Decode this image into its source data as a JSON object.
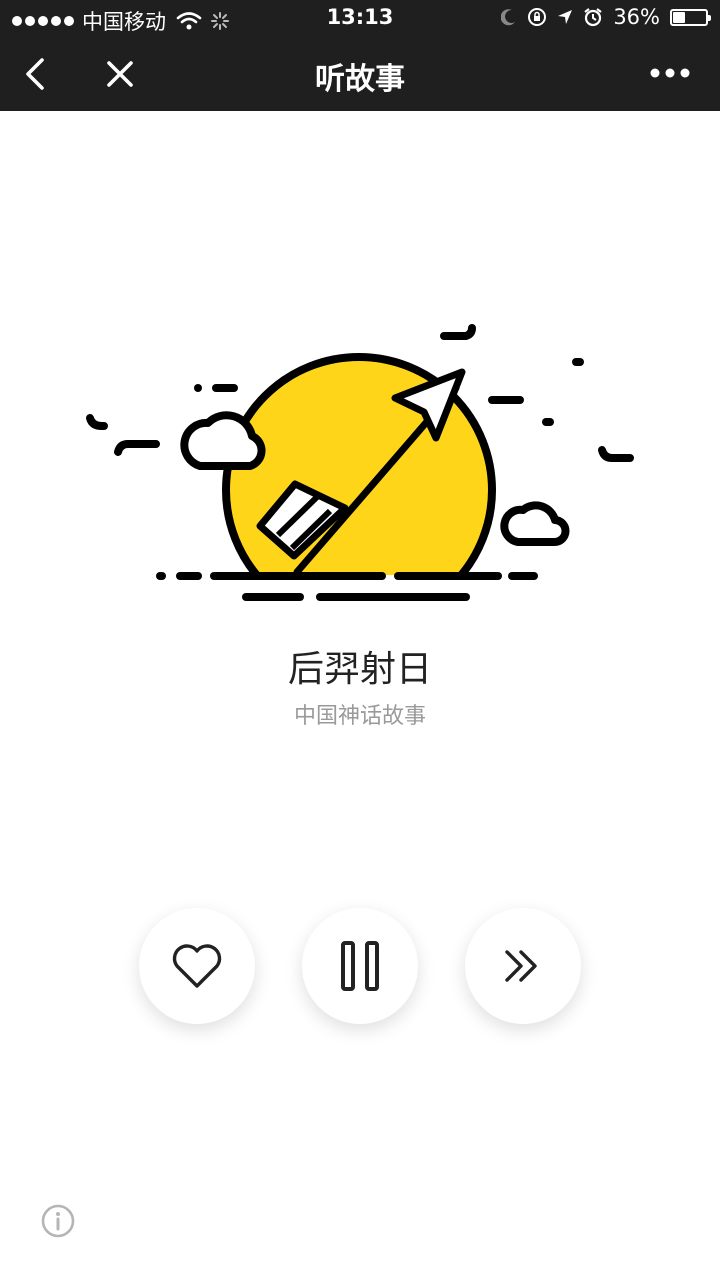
{
  "status_bar": {
    "carrier": "中国移动",
    "time": "13:13",
    "battery": "36%",
    "battery_level": 0.36
  },
  "nav": {
    "title": "听故事",
    "back_icon": "chevron-left-icon",
    "close_icon": "close-icon",
    "more_icon": "more-dots-icon"
  },
  "story": {
    "title": "后羿射日",
    "subtitle": "中国神话故事"
  },
  "controls": {
    "like_icon": "heart-icon",
    "pause_icon": "pause-icon",
    "next_icon": "double-chevron-right-icon"
  },
  "colors": {
    "sun": "#FFD51A",
    "bar": "#1f1f1f"
  }
}
